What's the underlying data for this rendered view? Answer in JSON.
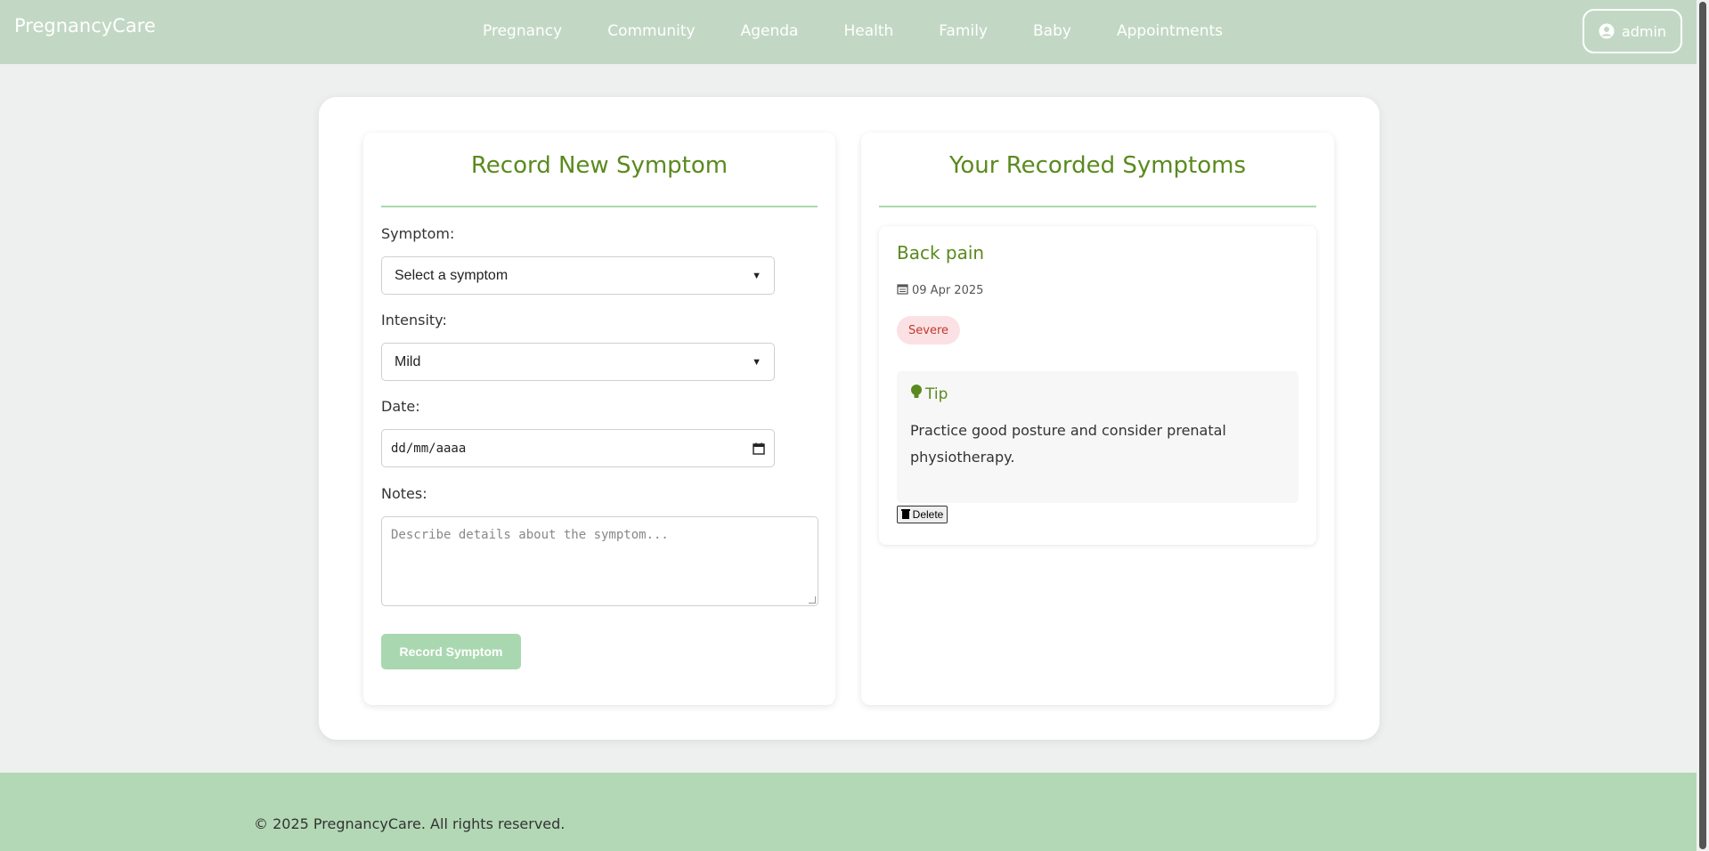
{
  "header": {
    "brand": "PregnancyCare",
    "nav": [
      "Pregnancy",
      "Community",
      "Agenda",
      "Health",
      "Family",
      "Baby",
      "Appointments"
    ],
    "user": {
      "name": "admin",
      "icon": "user-circle-icon"
    }
  },
  "form": {
    "title": "Record New Symptom",
    "symptom_label": "Symptom:",
    "symptom_value": "Select a symptom",
    "intensity_label": "Intensity:",
    "intensity_value": "Mild",
    "date_label": "Date:",
    "date_placeholder": "dd/mm/aaaa",
    "notes_label": "Notes:",
    "notes_placeholder": "Describe details about the symptom...",
    "submit_label": "Record Symptom"
  },
  "recorded": {
    "title": "Your Recorded Symptoms",
    "items": [
      {
        "name": "Back pain",
        "date": "09 Apr 2025",
        "intensity": "Severe",
        "tip_title": "Tip",
        "tip_text": "Practice good posture and consider prenatal physiotherapy.",
        "delete_label": "Delete"
      }
    ]
  },
  "footer": {
    "text": "© 2025 PregnancyCare. All rights reserved."
  },
  "colors": {
    "header_bg": "#c2d8c4",
    "accent_green": "#5a8a1e",
    "divider": "#a9d8b0",
    "button_bg": "#a9d8b0",
    "badge_bg": "#fbe1e4",
    "badge_text": "#c0392b",
    "footer_bg": "#b3d8b5"
  }
}
